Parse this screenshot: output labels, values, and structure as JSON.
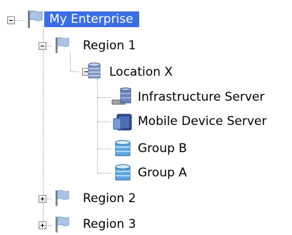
{
  "tree": {
    "root": {
      "label": "My Enterprise",
      "icon": "flag-icon",
      "expanded": true,
      "selected": true
    },
    "region1": {
      "label": "Region 1",
      "icon": "flag-icon",
      "expanded": true
    },
    "location_x": {
      "label": "Location X",
      "icon": "database-icon",
      "expanded": true
    },
    "infrastructure_server": {
      "label": "Infrastructure Server",
      "icon": "infrastructure-server-icon"
    },
    "mobile_device_server": {
      "label": "Mobile Device Server",
      "icon": "mobile-device-server-icon"
    },
    "group_b": {
      "label": "Group B",
      "icon": "group-icon"
    },
    "group_a": {
      "label": "Group A",
      "icon": "group-icon"
    },
    "region2": {
      "label": "Region 2",
      "icon": "flag-icon",
      "expanded": false
    },
    "region3": {
      "label": "Region 3",
      "icon": "flag-icon",
      "expanded": false
    }
  },
  "colors": {
    "selection": "#3a6ee6",
    "flag": "#a9c4e6",
    "database": "#7f97cc",
    "group": "#5fa6e0"
  }
}
